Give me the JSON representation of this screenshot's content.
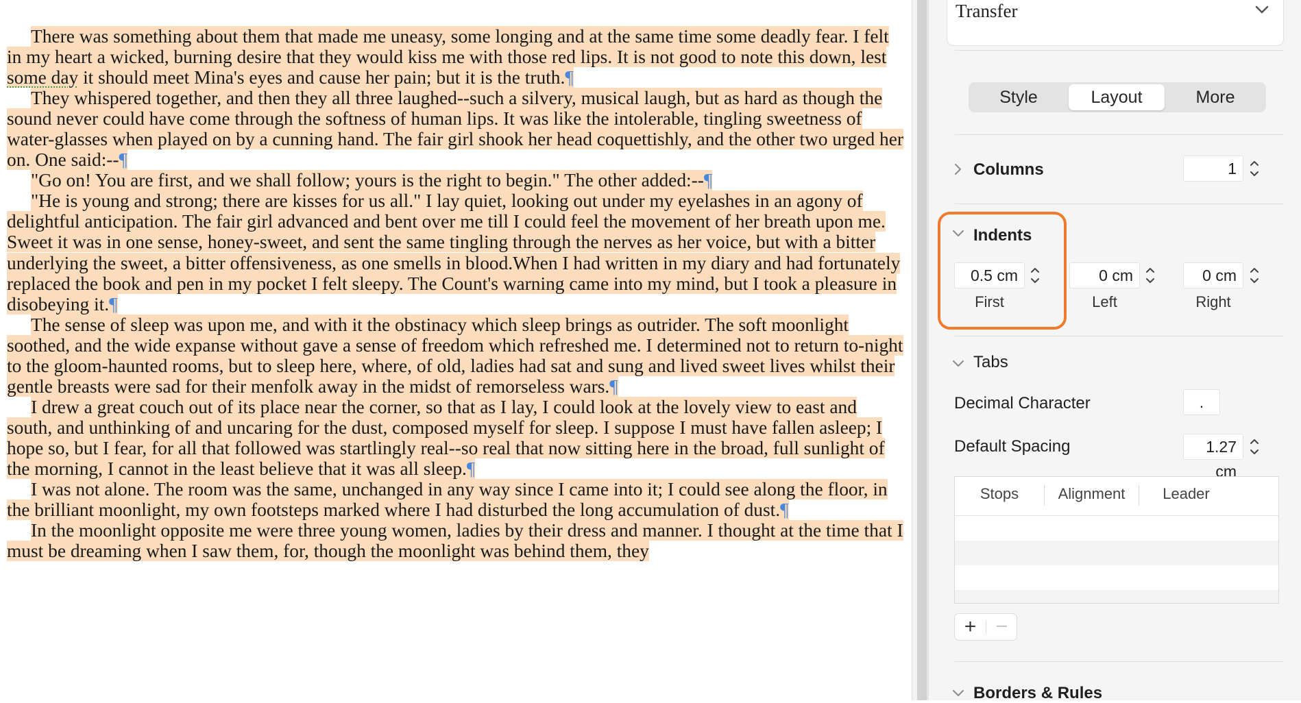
{
  "document": {
    "paragraphs": [
      "There was something about them that made me uneasy, some longing and at the same time some deadly fear. I felt in my heart a wicked, burning desire that they would kiss me with those red lips. It is not good to note this down, lest some day it should meet Mina's eyes and cause her pain; but it is the truth.",
      "They whispered together, and then they all three laughed--such a silvery, musical laugh, but as hard as though the sound never could have come through the softness of human lips. It was like the intolerable, tingling sweetness of water-glasses when played on by a cunning hand. The fair girl shook her head coquettishly, and the other two urged her on. One said:--",
      "\"Go on! You are first, and we shall follow; yours is the right to begin.\" The other added:--",
      "\"He is young and strong; there are kisses for us all.\" I lay quiet, looking out under my eyelashes in an agony of delightful anticipation. The fair girl advanced and bent over me till I could feel the movement of her breath upon me. Sweet it was in one sense, honey-sweet, and sent the same tingling through the nerves as her voice, but with a bitter underlying the sweet, a bitter offensiveness, as one smells in blood.When I had written in my diary and had fortunately replaced the book and pen in my pocket I felt sleepy. The Count's warning came into my mind, but I took a pleasure in disobeying it.",
      "The sense of sleep was upon me, and with it the obstinacy which sleep brings as outrider. The soft moonlight soothed, and the wide expanse without gave a sense of freedom which refreshed me. I determined not to return to-night to the gloom-haunted rooms, but to sleep here, where, of old, ladies had sat and sung and lived sweet lives whilst their gentle breasts were sad for their menfolk away in the midst of remorseless wars.",
      "I drew a great couch out of its place near the corner, so that as I lay, I could look at the lovely view to east and south, and unthinking of and uncaring for the dust, composed myself for sleep. I suppose I must have fallen asleep; I hope so, but I fear, for all that followed was startlingly real--so real that now sitting here in the broad, full sunlight of the morning, I cannot in the least believe that it was all sleep.",
      "I was not alone. The room was the same, unchanged in any way since I came into it; I could see along the floor, in the brilliant moonlight, my own footsteps marked where I had disturbed the long accumulation of dust.",
      "In the moonlight opposite me were three young women, ladies by their dress and manner. I thought at the time that I must be dreaming when I saw them, for, though the moonlight was behind them, they"
    ],
    "pilcrow": "¶",
    "highlight_color": "#fbdcbd",
    "pilcrow_color": "#4a86d9",
    "spellcheck_word": "some day"
  },
  "inspector": {
    "transfer_label": "Transfer",
    "tabs": [
      "Style",
      "Layout",
      "More"
    ],
    "active_tab": "Layout",
    "columns": {
      "label": "Columns",
      "value": "1"
    },
    "indents": {
      "label": "Indents",
      "first": {
        "value": "0.5 cm",
        "label": "First"
      },
      "left": {
        "value": "0 cm",
        "label": "Left"
      },
      "right": {
        "value": "0 cm",
        "label": "Right"
      },
      "highlight_color": "#ee7b2e"
    },
    "tabs_section": {
      "label": "Tabs",
      "decimal_character": {
        "label": "Decimal Character",
        "value": "."
      },
      "default_spacing": {
        "label": "Default Spacing",
        "value": "1.27 cm"
      },
      "table_headers": [
        "Stops",
        "Alignment",
        "Leader"
      ],
      "add_label": "+",
      "remove_label": "−"
    },
    "borders_label": "Borders & Rules"
  }
}
